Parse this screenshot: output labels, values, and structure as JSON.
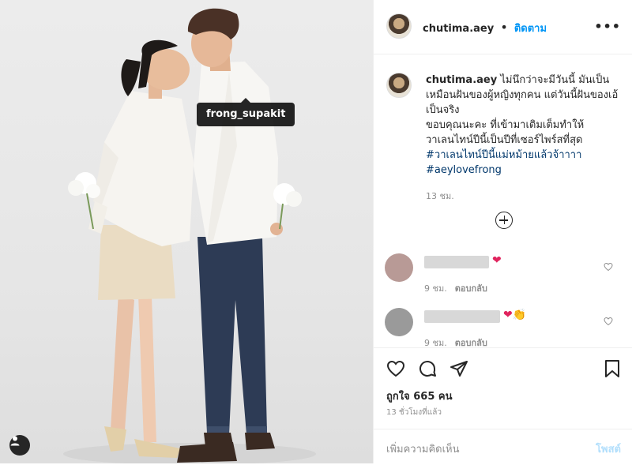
{
  "photo": {
    "tag_label": "frong_supakit"
  },
  "post": {
    "username": "chutima.aey",
    "separator": "•",
    "follow_label": "ติดตาม",
    "more_label": "•••",
    "caption_username": "chutima.aey",
    "caption_line1": "ไม่นึกว่าจะมีวันนี้ มันเป็นเหมือนฝันของผู้หญิงทุกคน แต่วันนี้ฝันของเอ้เป็นจริง",
    "caption_line2": "ขอบคุณนะคะ ที่เข้ามาเติมเต็มทำให้วาเลนไทน์ปีนี้เป็นปีที่เซอร์ไพร์สที่สุด ",
    "hashtag1": "#วาเลนไทน์ปีนี้แม่หม้ายแล้วจ้าาาา",
    "hashtag2": "#aeylovefrong",
    "caption_time": "13 ชม."
  },
  "comments": [
    {
      "emoji": "❤",
      "time": "9 ชม.",
      "reply_label": "ตอบกลับ",
      "avatar_color": "#b89a96"
    },
    {
      "emoji": "❤👏",
      "time": "9 ชม.",
      "reply_label": "ตอบกลับ",
      "avatar_color": "#9a9a9a"
    }
  ],
  "footer": {
    "likes_text": "ถูกใจ 665 คน",
    "post_time": "13 ชั่วโมงที่แล้ว",
    "comment_placeholder": "เพิ่มความคิดเห็น",
    "post_button": "โพสต์"
  },
  "icons": {
    "like": "heart-icon",
    "comment": "comment-icon",
    "share": "share-icon",
    "save": "bookmark-icon",
    "add_comments": "plus-circle-icon",
    "user_tags": "person-icon",
    "options": "more-icon"
  },
  "colors": {
    "accent": "#0095f6",
    "hashtag": "#00376b",
    "heart": "#e0245e",
    "post_disabled": "#b2dffc"
  }
}
